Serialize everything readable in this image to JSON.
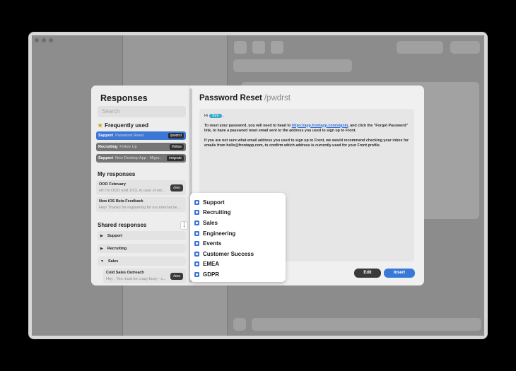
{
  "modal": {
    "title": "Responses",
    "search_placeholder": "Search",
    "frequently_used_label": "Frequently used",
    "frequently_used": [
      {
        "team": "Support",
        "name": "Password Reset",
        "shortcut": "/pwdrst",
        "active": true
      },
      {
        "team": "Recruiting",
        "name": "Follow Up",
        "shortcut": "/follow",
        "active": false
      },
      {
        "team": "Support",
        "name": "New Desktop App - Migra...",
        "shortcut": "/migrate",
        "active": false
      }
    ],
    "my_responses_label": "My responses",
    "my_responses": [
      {
        "title": "OOO February",
        "preview": "Hi! I'm OOO until 2/23, in case of em...",
        "shortcut": "/ooo"
      },
      {
        "title": "New iOS Beta Feedback",
        "preview": "Hey! Thanks for registering for our internal be...",
        "shortcut": ""
      }
    ],
    "shared_responses_label": "Shared responses",
    "kebab": "⋮",
    "shared_folders": [
      {
        "name": "Support",
        "arrow": "▶"
      },
      {
        "name": "Recruiting",
        "arrow": "▶"
      },
      {
        "name": "Sales",
        "arrow": "▼"
      }
    ],
    "shared_item": {
      "title": "Cold Sales Outreach",
      "preview": "Hey , You must be crazy busy - so...",
      "shortcut": "/ooo"
    },
    "detail": {
      "title": "Password Reset",
      "shortcut": "/pwdrst",
      "greeting_prefix": "Hi",
      "name_tag": "Tom",
      "greeting_suffix": ",",
      "para1_a": "To reset your password, you will need to head to",
      "para1_link": "https://app.frontapp.com/signin",
      "para1_b": ", and click the \"Forgot Password\" link, to have a password reset email sent to the address you used to sign up to Front.",
      "para2": "If you are not sure what email address you used to sign up to Front, we would recommend checking your inbox for emails from hello@frontapp.com, to confirm which address is currently used for your Front profile."
    },
    "buttons": {
      "edit": "Edit",
      "insert": "Insert"
    }
  },
  "menu": {
    "items": [
      "Support",
      "Recruiting",
      "Sales",
      "Engineering",
      "Events",
      "Customer Success",
      "EMEA",
      "GDPR"
    ]
  },
  "colors": {
    "accent": "#3a78d8",
    "tag": "#3aa9c9"
  }
}
